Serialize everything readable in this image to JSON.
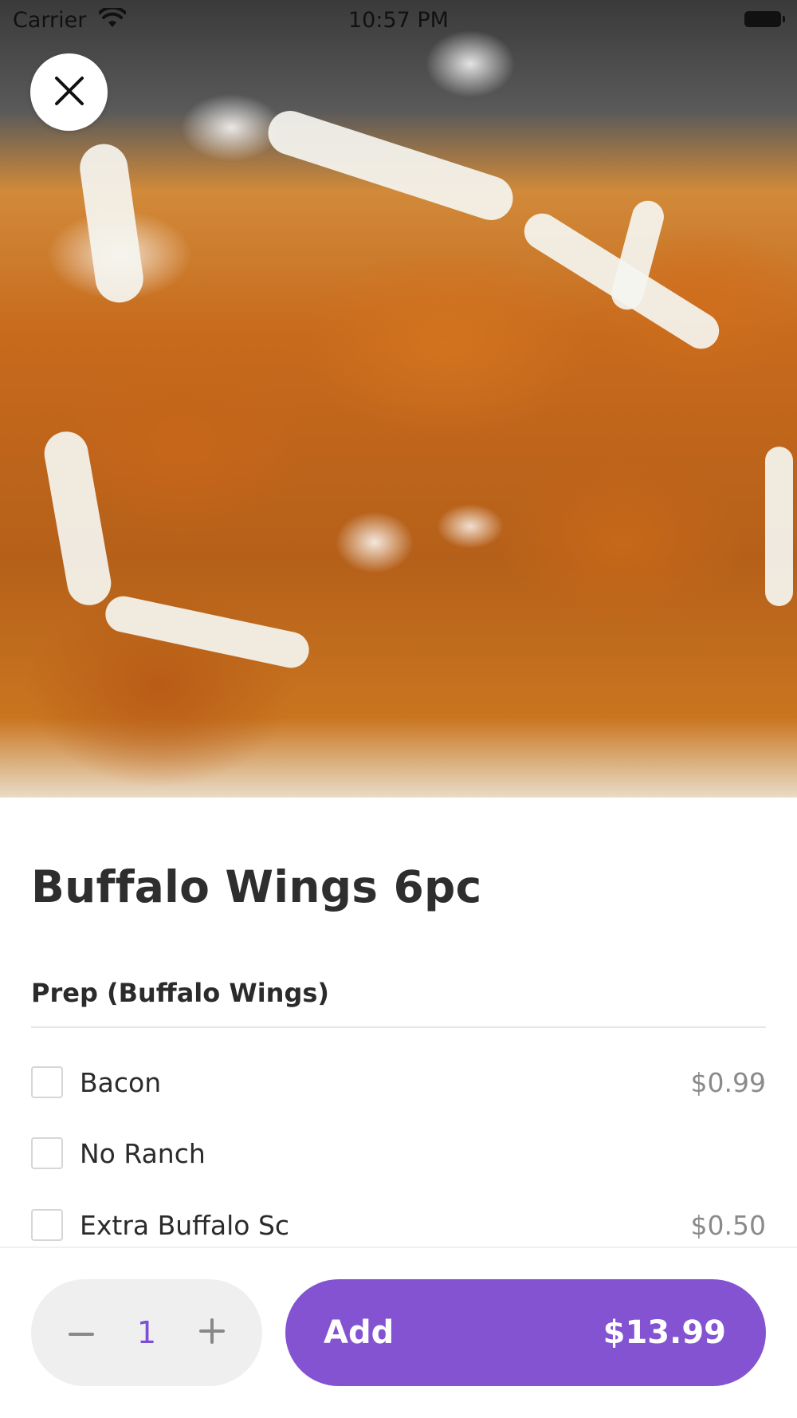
{
  "status_bar": {
    "carrier": "Carrier",
    "time": "10:57 PM",
    "wifi_icon": "wifi-icon",
    "battery_icon": "battery-icon"
  },
  "hero": {
    "image_subject": "buffalo wings with ranch and blue cheese",
    "close_icon": "close-icon"
  },
  "item": {
    "title": "Buffalo Wings 6pc"
  },
  "modifier_group": {
    "title": "Prep (Buffalo Wings)",
    "options": [
      {
        "label": "Bacon",
        "price": "$0.99",
        "checked": false
      },
      {
        "label": "No Ranch",
        "price": "",
        "checked": false
      },
      {
        "label": "Extra Buffalo Sc",
        "price": "$0.50",
        "checked": false
      }
    ]
  },
  "footer": {
    "quantity": "1",
    "minus_icon": "minus-icon",
    "plus_icon": "plus-icon",
    "add_label": "Add",
    "add_price": "$13.99"
  },
  "colors": {
    "accent": "#8453D2",
    "stepper_bg": "#EFEFEF",
    "price_text": "#8A8A8A"
  }
}
